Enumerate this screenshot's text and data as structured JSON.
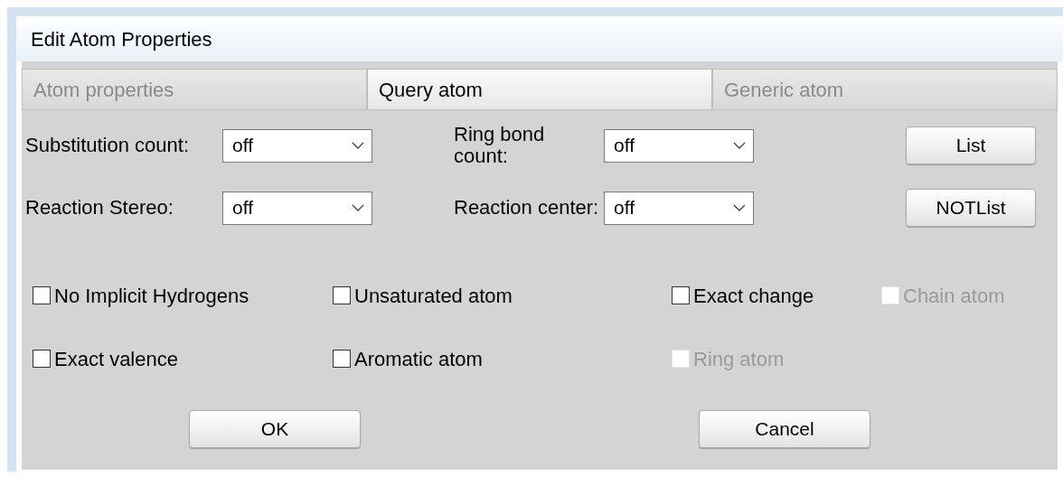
{
  "window": {
    "title": "Edit Atom Properties"
  },
  "tabs": [
    {
      "label": "Atom properties",
      "selected": false
    },
    {
      "label": "Query atom",
      "selected": true
    },
    {
      "label": "Generic atom",
      "selected": false
    }
  ],
  "fields": [
    {
      "label": "Substitution count:",
      "value": "off"
    },
    {
      "label": "Ring bond count:",
      "value": "off"
    },
    {
      "label": "Reaction Stereo:",
      "value": "off"
    },
    {
      "label": "Reaction center:",
      "value": "off"
    }
  ],
  "side_buttons": [
    "List",
    "NOTList"
  ],
  "checkbox_rows": [
    [
      {
        "label": "No Implicit Hydrogens",
        "checked": false,
        "disabled": false
      },
      {
        "label": "Unsaturated atom",
        "checked": false,
        "disabled": false
      },
      {
        "label": "Exact change",
        "checked": false,
        "disabled": false
      },
      {
        "label": "Chain atom",
        "checked": false,
        "disabled": true
      }
    ],
    [
      {
        "label": "Exact valence",
        "checked": false,
        "disabled": false
      },
      {
        "label": "Aromatic atom",
        "checked": false,
        "disabled": false
      },
      {
        "label": "Ring atom",
        "checked": false,
        "disabled": true
      }
    ]
  ],
  "buttons": [
    "OK",
    "Cancel"
  ]
}
